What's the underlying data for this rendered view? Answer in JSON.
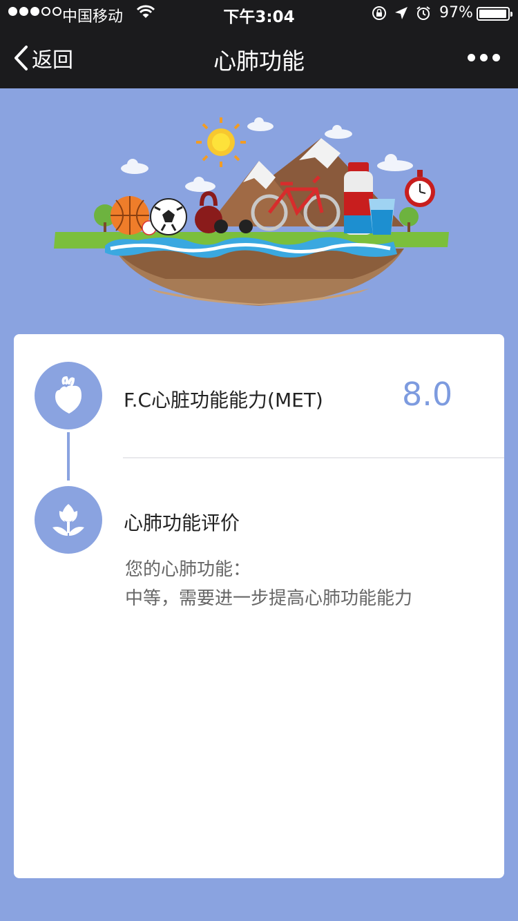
{
  "status_bar": {
    "carrier": "中国移动",
    "time": "下午3:04",
    "battery": "97%",
    "battery_level": 0.97
  },
  "nav": {
    "back_label": "返回",
    "title": "心肺功能"
  },
  "result": {
    "fc_label": "F.C心脏功能能力(MET)",
    "fc_value": "8.0"
  },
  "evaluation": {
    "title": "心肺功能评价",
    "line1": "您的心肺功能：",
    "line2": "中等，需要进一步提高心肺功能能力"
  },
  "colors": {
    "accent": "#8aa3e0",
    "value": "#7d9bdf",
    "nav_bg": "#1b1b1d"
  }
}
